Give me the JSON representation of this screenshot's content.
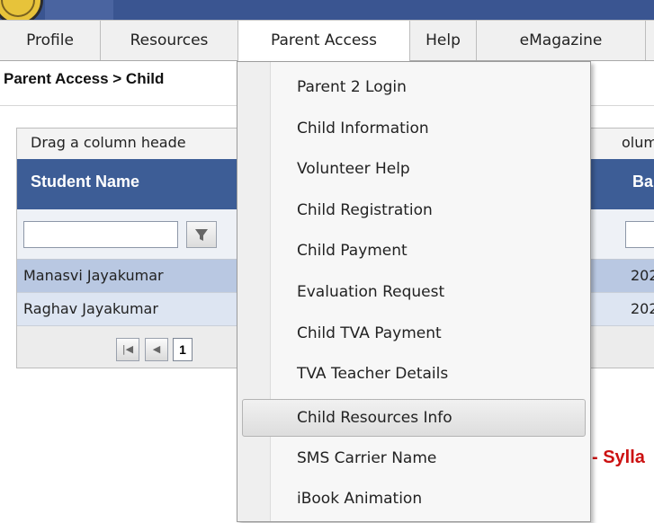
{
  "menubar": {
    "items": [
      {
        "label": "Profile"
      },
      {
        "label": "Resources"
      },
      {
        "label": "Parent Access"
      },
      {
        "label": "Help"
      },
      {
        "label": "eMagazine"
      }
    ]
  },
  "breadcrumb": "Parent Access > Child",
  "grid": {
    "group_hint": "Drag a column heade",
    "group_hint_tail": "olumn",
    "columns": [
      "Student Name",
      "Ba"
    ],
    "rows": [
      {
        "name": "Manasvi Jayakumar",
        "batch": "202"
      },
      {
        "name": "Raghav Jayakumar",
        "batch": "202"
      }
    ],
    "pager": {
      "current_page": "1"
    }
  },
  "red_text": "- Sylla",
  "dropdown": {
    "items": [
      {
        "label": "Parent 2 Login"
      },
      {
        "label": "Child Information"
      },
      {
        "label": "Volunteer Help"
      },
      {
        "label": "Child Registration"
      },
      {
        "label": "Child Payment"
      },
      {
        "label": "Evaluation Request"
      },
      {
        "label": "Child TVA Payment"
      },
      {
        "label": "TVA Teacher Details"
      },
      {
        "label": "Child Resources Info"
      },
      {
        "label": "SMS Carrier Name"
      },
      {
        "label": "iBook Animation"
      }
    ],
    "hovered_index": 8
  },
  "colors": {
    "banner": "#3a5591",
    "grid_header": "#3d5d96",
    "selected_row": "#b9c8e2",
    "red_text": "#cc1111"
  },
  "icons": [
    "filter-icon",
    "first-page-icon",
    "prev-page-icon"
  ]
}
